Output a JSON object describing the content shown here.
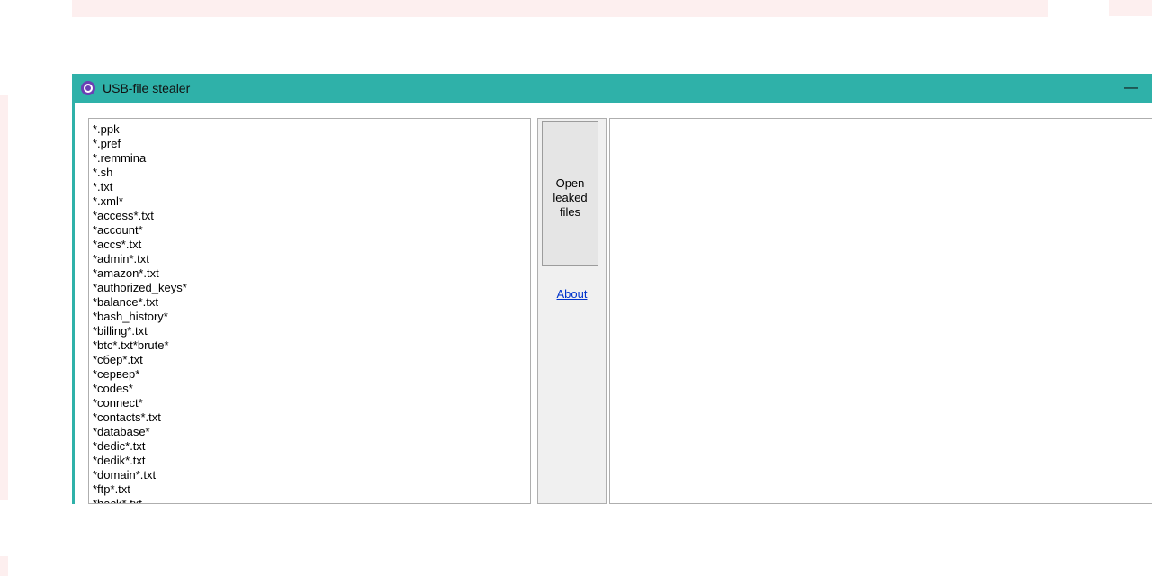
{
  "window": {
    "title": "USB-file stealer",
    "minimize_glyph": "—"
  },
  "buttons": {
    "open_leaked_files": "Open\nleaked\nfiles",
    "about": "About"
  },
  "patterns": [
    "*.ppk",
    "*.pref",
    "*.remmina",
    "*.sh",
    "*.txt",
    "*.xml*",
    "*access*.txt",
    "*account*",
    "*accs*.txt",
    "*admin*.txt",
    "*amazon*.txt",
    "*authorized_keys*",
    "*balance*.txt",
    "*bash_history*",
    "*billing*.txt",
    "*btc*.txt*brute*",
    "*сбер*.txt",
    "*сервер*",
    "*codes*",
    "*connect*",
    "*contacts*.txt",
    "*database*",
    "*dedic*.txt",
    "*dedik*.txt",
    "*domain*.txt",
    "*ftp*.txt",
    "*hack*.txt"
  ]
}
